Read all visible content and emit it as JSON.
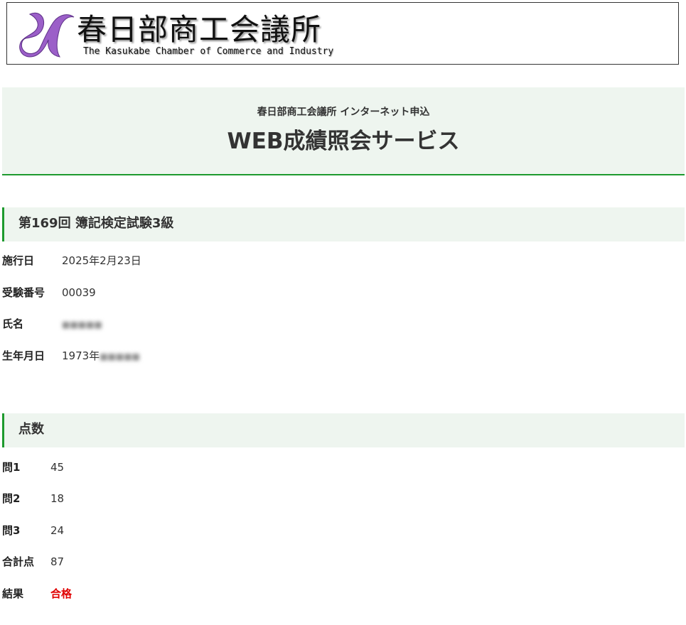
{
  "logo": {
    "title": "春日部商工会議所",
    "subtitle": "The Kasukabe Chamber of Commerce and Industry",
    "mark_color": "#9b5fc8"
  },
  "service": {
    "subtitle": "春日部商工会議所 インターネット申込",
    "title": "WEB成績照会サービス"
  },
  "exam": {
    "heading": "第169回 簿記検定試験3級",
    "fields": [
      {
        "label": "施行日",
        "value": "2025年2月23日"
      },
      {
        "label": "受験番号",
        "value": "00039"
      },
      {
        "label": "氏名",
        "value": "",
        "redacted": true
      },
      {
        "label": "生年月日",
        "value": "1973年",
        "redacted_suffix": true
      }
    ]
  },
  "score": {
    "heading": "点数",
    "rows": [
      {
        "label": "問1",
        "value": "45"
      },
      {
        "label": "問2",
        "value": "18"
      },
      {
        "label": "問3",
        "value": "24"
      },
      {
        "label": "合計点",
        "value": "87"
      },
      {
        "label": "結果",
        "value": "合格"
      }
    ]
  },
  "colors": {
    "accent_green": "#1e9a2e",
    "header_bg": "#eef5ef",
    "pass_red": "#e00000"
  }
}
